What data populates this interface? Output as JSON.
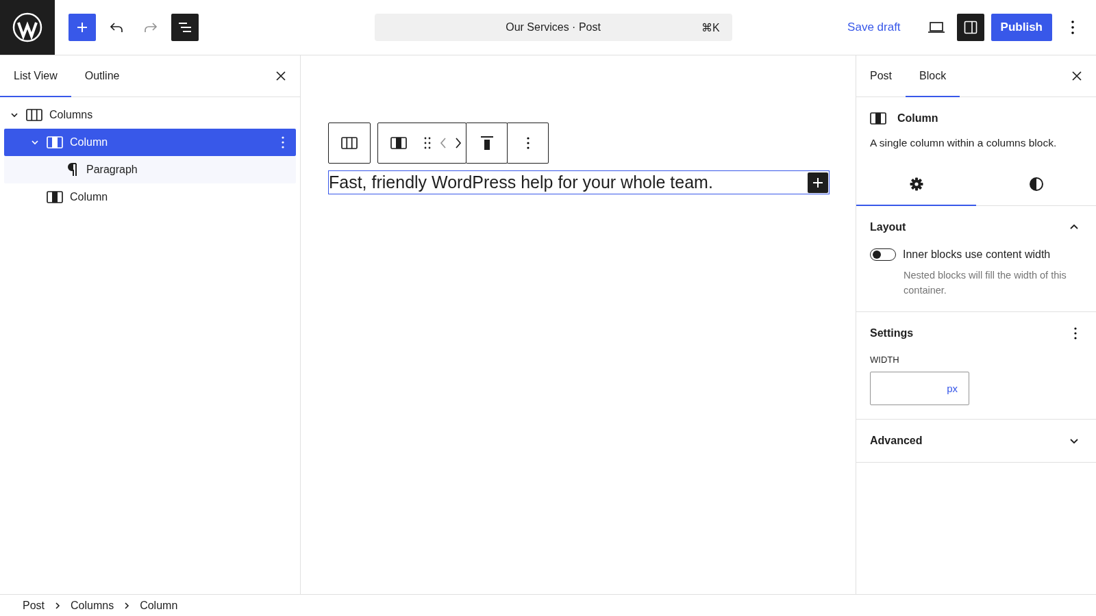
{
  "header": {
    "inserter": {
      "selected": true
    },
    "redo": {
      "disabled": true
    },
    "overview": {
      "selected": true
    },
    "command_bar": {
      "title": "Our Services · Post",
      "shortcut": "⌘K"
    },
    "save_draft": "Save draft",
    "settings_toggle": {
      "selected": true
    },
    "publish": "Publish"
  },
  "list_panel": {
    "tabs": [
      {
        "label": "List View",
        "selected": true
      },
      {
        "label": "Outline",
        "selected": false
      }
    ],
    "tree": [
      {
        "kind": "columns",
        "label": "Columns",
        "expanded": true,
        "selected": false,
        "children": [
          {
            "kind": "column",
            "label": "Column",
            "expanded": true,
            "selected": true,
            "children": [
              {
                "kind": "paragraph",
                "label": "Paragraph",
                "selected": false
              }
            ]
          },
          {
            "kind": "column",
            "label": "Column",
            "selected": false
          }
        ]
      }
    ]
  },
  "canvas": {
    "paragraph": "Fast, friendly WordPress help for your whole team."
  },
  "inspector": {
    "tabs": [
      {
        "label": "Post",
        "selected": false
      },
      {
        "label": "Block",
        "selected": true
      }
    ],
    "block_name": "Column",
    "block_description": "A single column within a columns block.",
    "subtabs": [
      {
        "kind": "settings",
        "selected": true
      },
      {
        "kind": "styles",
        "selected": false
      }
    ],
    "panels": [
      {
        "kind": "layout",
        "title": "Layout",
        "expanded": true,
        "toggle": {
          "checked": false,
          "label": "Inner blocks use content width",
          "help": "Nested blocks will fill the width of this container."
        }
      },
      {
        "kind": "settings",
        "title": "Settings",
        "field_label": "WIDTH",
        "unit": "px"
      },
      {
        "kind": "advanced",
        "title": "Advanced",
        "expanded": false
      }
    ]
  },
  "breadcrumb": [
    "Post",
    "Columns",
    "Column"
  ]
}
